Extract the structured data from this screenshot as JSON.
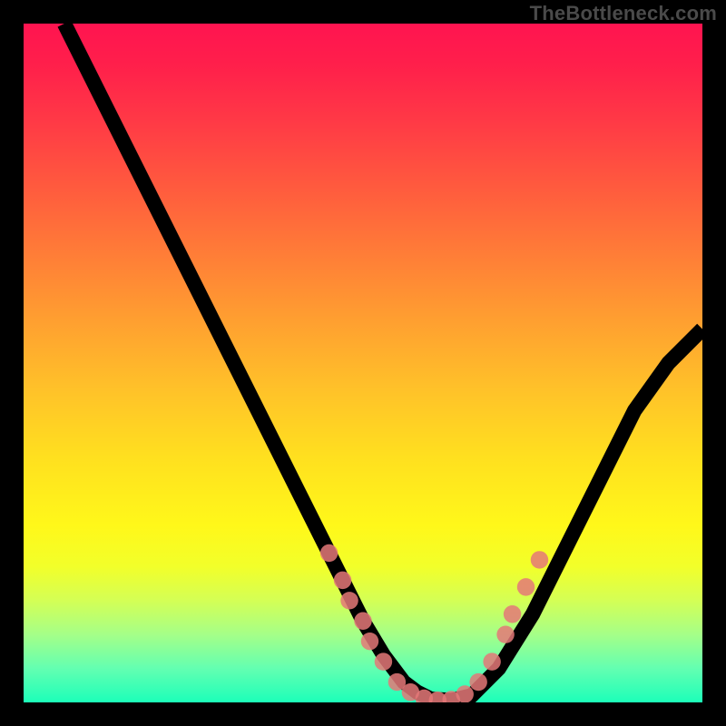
{
  "watermark": "TheBottleneck.com",
  "chart_data": {
    "type": "line",
    "title": "",
    "xlabel": "",
    "ylabel": "",
    "xlim": [
      0,
      100
    ],
    "ylim": [
      0,
      100
    ],
    "gradient_stops": [
      {
        "pct": 0,
        "color": "#ff1450"
      },
      {
        "pct": 6,
        "color": "#ff1f4b"
      },
      {
        "pct": 14,
        "color": "#ff3846"
      },
      {
        "pct": 24,
        "color": "#ff5a3e"
      },
      {
        "pct": 34,
        "color": "#ff7d37"
      },
      {
        "pct": 44,
        "color": "#ffa030"
      },
      {
        "pct": 54,
        "color": "#ffc229"
      },
      {
        "pct": 64,
        "color": "#ffe01f"
      },
      {
        "pct": 74,
        "color": "#fff81a"
      },
      {
        "pct": 80,
        "color": "#f2ff2a"
      },
      {
        "pct": 85,
        "color": "#d4ff55"
      },
      {
        "pct": 90,
        "color": "#a5ff88"
      },
      {
        "pct": 95,
        "color": "#63ffb1"
      },
      {
        "pct": 100,
        "color": "#1cffb9"
      }
    ],
    "series": [
      {
        "name": "bottleneck-curve",
        "x": [
          6,
          10,
          15,
          20,
          25,
          30,
          35,
          40,
          45,
          50,
          53,
          56,
          58,
          60,
          63,
          66,
          70,
          75,
          80,
          85,
          90,
          95,
          100
        ],
        "y": [
          100,
          92,
          82,
          72,
          62,
          52,
          42,
          32,
          22,
          12,
          7,
          3,
          1.5,
          0.5,
          0.3,
          1,
          5,
          13,
          23,
          33,
          43,
          50,
          55
        ]
      }
    ],
    "markers": {
      "name": "highlighted-points",
      "color": "#e47878",
      "points": [
        {
          "x": 45,
          "y": 22
        },
        {
          "x": 47,
          "y": 18
        },
        {
          "x": 48,
          "y": 15
        },
        {
          "x": 50,
          "y": 12
        },
        {
          "x": 51,
          "y": 9
        },
        {
          "x": 53,
          "y": 6
        },
        {
          "x": 55,
          "y": 3
        },
        {
          "x": 57,
          "y": 1.5
        },
        {
          "x": 59,
          "y": 0.6
        },
        {
          "x": 61,
          "y": 0.3
        },
        {
          "x": 63,
          "y": 0.4
        },
        {
          "x": 65,
          "y": 1.2
        },
        {
          "x": 67,
          "y": 3
        },
        {
          "x": 69,
          "y": 6
        },
        {
          "x": 71,
          "y": 10
        },
        {
          "x": 72,
          "y": 13
        },
        {
          "x": 74,
          "y": 17
        },
        {
          "x": 76,
          "y": 21
        }
      ]
    }
  }
}
